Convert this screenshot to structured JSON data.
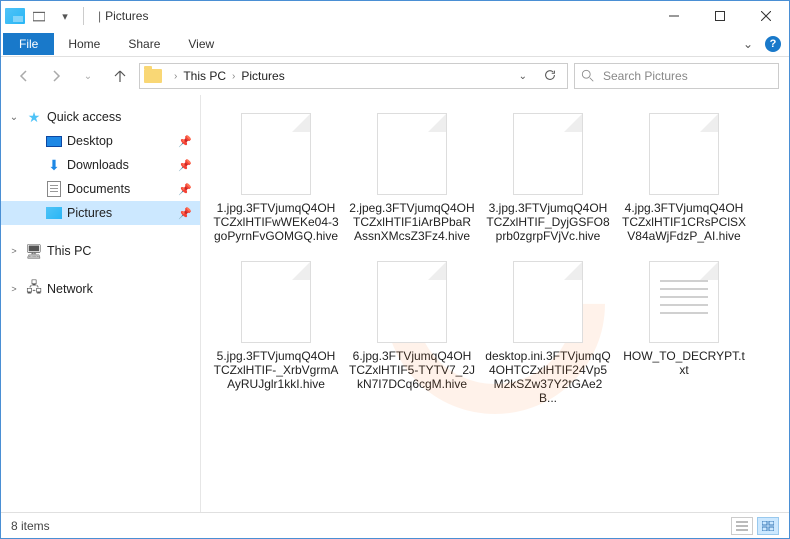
{
  "title": {
    "sep": "|",
    "label": "Pictures"
  },
  "ribbon": {
    "file": "File",
    "home": "Home",
    "share": "Share",
    "view": "View"
  },
  "breadcrumb": {
    "root": "This PC",
    "current": "Pictures"
  },
  "search": {
    "placeholder": "Search Pictures"
  },
  "sidebar": {
    "quick_access": "Quick access",
    "items": [
      {
        "label": "Desktop"
      },
      {
        "label": "Downloads"
      },
      {
        "label": "Documents"
      },
      {
        "label": "Pictures"
      }
    ],
    "this_pc": "This PC",
    "network": "Network"
  },
  "files": [
    {
      "name": "1.jpg.3FTVjumqQ4OHTCZxlHTIFwWEKe04-3goPyrnFvGOMGQ.hive",
      "type": "blank"
    },
    {
      "name": "2.jpeg.3FTVjumqQ4OHTCZxlHTIF1iArBPbaRAssnXMcsZ3Fz4.hive",
      "type": "blank"
    },
    {
      "name": "3.jpg.3FTVjumqQ4OHTCZxlHTIF_DyjGSFO8prb0zgrpFVjVc.hive",
      "type": "blank"
    },
    {
      "name": "4.jpg.3FTVjumqQ4OHTCZxlHTIF1CRsPClSXV84aWjFdzP_AI.hive",
      "type": "blank"
    },
    {
      "name": "5.jpg.3FTVjumqQ4OHTCZxlHTIF-_XrbVgrmAAyRUJglr1kkI.hive",
      "type": "blank"
    },
    {
      "name": "6.jpg.3FTVjumqQ4OHTCZxlHTIF5-TYTV7_2JkN7I7DCq6cgM.hive",
      "type": "blank"
    },
    {
      "name": "desktop.ini.3FTVjumqQ4OHTCZxlHTIF24Vp5M2kSZw37Y2tGAe2B...",
      "type": "blank"
    },
    {
      "name": "HOW_TO_DECRYPT.txt",
      "type": "txt"
    }
  ],
  "status": {
    "count_label": "8 items"
  }
}
